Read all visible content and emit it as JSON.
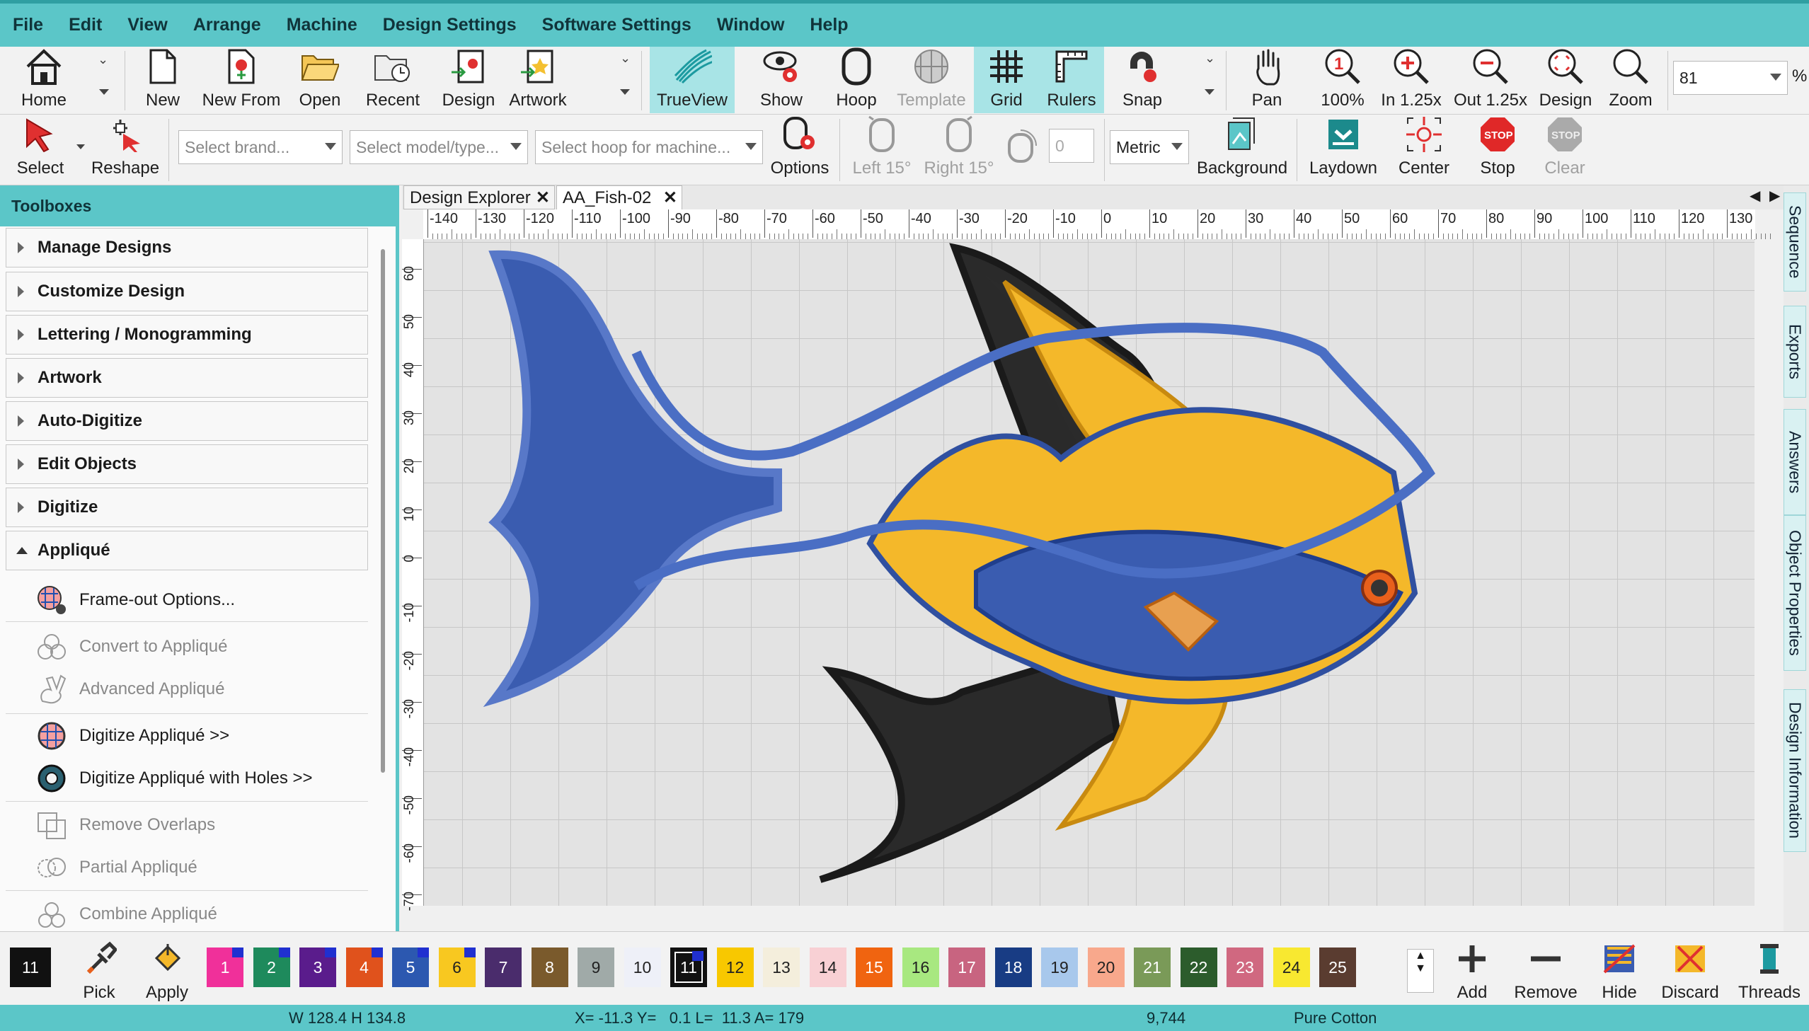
{
  "menu": [
    "File",
    "Edit",
    "View",
    "Arrange",
    "Machine",
    "Design Settings",
    "Software Settings",
    "Window",
    "Help"
  ],
  "toolbar1": {
    "home": "Home",
    "new": "New",
    "new_from": "New From",
    "open": "Open",
    "recent": "Recent",
    "design": "Design",
    "artwork": "Artwork",
    "trueview": "TrueView",
    "show": "Show",
    "hoop": "Hoop",
    "template": "Template",
    "grid": "Grid",
    "rulers": "Rulers",
    "snap": "Snap",
    "pan": "Pan",
    "zoom100": "100%",
    "zoom_in": "In 1.25x",
    "zoom_out": "Out 1.25x",
    "zoom_design": "Design",
    "zoom": "Zoom",
    "zoom_value": "81",
    "zoom_unit": "%"
  },
  "toolbar2": {
    "select": "Select",
    "reshape": "Reshape",
    "brand_placeholder": "Select brand...",
    "model_placeholder": "Select model/type...",
    "hoop_placeholder": "Select hoop for machine...",
    "options": "Options",
    "left15": "Left 15°",
    "right15": "Right 15°",
    "rotate_value": "0",
    "units": "Metric",
    "background": "Background",
    "laydown": "Laydown",
    "center": "Center",
    "stop": "Stop",
    "clear": "Clear"
  },
  "toolboxes": {
    "title": "Toolboxes",
    "categories": [
      "Manage Designs",
      "Customize Design",
      "Lettering / Monogramming",
      "Artwork",
      "Auto-Digitize",
      "Edit Objects",
      "Digitize",
      "Appliqué"
    ],
    "applique_items": [
      "Frame-out Options...",
      "Convert to Appliqué",
      "Advanced Appliqué",
      "Digitize Appliqué >>",
      "Digitize Appliqué with Holes >>",
      "Remove Overlaps",
      "Partial Appliqué",
      "Combine Appliqué"
    ]
  },
  "tabs": {
    "explorer": "Design Explorer",
    "file": "AA_Fish-02"
  },
  "ruler": {
    "h": [
      "-140",
      "-130",
      "-120",
      "-110",
      "-100",
      "-90",
      "-80",
      "-70",
      "-60",
      "-50",
      "-40",
      "-30",
      "-20",
      "-10",
      "0",
      "10",
      "20",
      "30",
      "40",
      "50",
      "60",
      "70",
      "80",
      "90",
      "100",
      "110",
      "120",
      "130"
    ],
    "v": [
      "60",
      "50",
      "40",
      "30",
      "20",
      "10",
      "0",
      "-10",
      "-20",
      "-30",
      "-40",
      "-50",
      "-60",
      "-70"
    ]
  },
  "side_tabs": [
    "Sequence",
    "Exports",
    "Answers",
    "Object Properties",
    "Design Information"
  ],
  "palette": {
    "current": "11",
    "pick": "Pick",
    "apply": "Apply",
    "swatches": [
      {
        "n": "1",
        "c": "#f0309a",
        "dot": true
      },
      {
        "n": "2",
        "c": "#1e8a5c",
        "dot": true
      },
      {
        "n": "3",
        "c": "#5a1c8c",
        "dot": true
      },
      {
        "n": "4",
        "c": "#e0521c",
        "dot": true
      },
      {
        "n": "5",
        "c": "#2c58b0",
        "dot": true
      },
      {
        "n": "6",
        "c": "#f8c820",
        "dot": true
      },
      {
        "n": "7",
        "c": "#4a2c6c",
        "dot": false
      },
      {
        "n": "8",
        "c": "#7a5a2c",
        "dot": false
      },
      {
        "n": "9",
        "c": "#a0aaa8",
        "dot": false
      },
      {
        "n": "10",
        "c": "#eef0f8",
        "dot": false
      },
      {
        "n": "11",
        "c": "#111111",
        "dot": true
      },
      {
        "n": "12",
        "c": "#f8c800",
        "dot": false
      },
      {
        "n": "13",
        "c": "#f4eedc",
        "dot": false
      },
      {
        "n": "14",
        "c": "#f8d0d4",
        "dot": false
      },
      {
        "n": "15",
        "c": "#f06410",
        "dot": false
      },
      {
        "n": "16",
        "c": "#a8e880",
        "dot": false
      },
      {
        "n": "17",
        "c": "#c86480",
        "dot": false
      },
      {
        "n": "18",
        "c": "#183c84",
        "dot": false
      },
      {
        "n": "19",
        "c": "#a8c8ec",
        "dot": false
      },
      {
        "n": "20",
        "c": "#f8a88c",
        "dot": false
      },
      {
        "n": "21",
        "c": "#7a9a58",
        "dot": false
      },
      {
        "n": "22",
        "c": "#2c5c2c",
        "dot": false
      },
      {
        "n": "23",
        "c": "#d06880",
        "dot": false
      },
      {
        "n": "24",
        "c": "#f8e830",
        "dot": false
      },
      {
        "n": "25",
        "c": "#5a3c30",
        "dot": false
      }
    ],
    "add": "Add",
    "remove": "Remove",
    "hide": "Hide",
    "discard": "Discard",
    "threads": "Threads"
  },
  "status": {
    "size": "W 128.4 H 134.8",
    "coords": "X= -11.3 Y=   0.1 L=  11.3 A= 179",
    "stitches": "9,744",
    "thread": "Pure Cotton"
  }
}
